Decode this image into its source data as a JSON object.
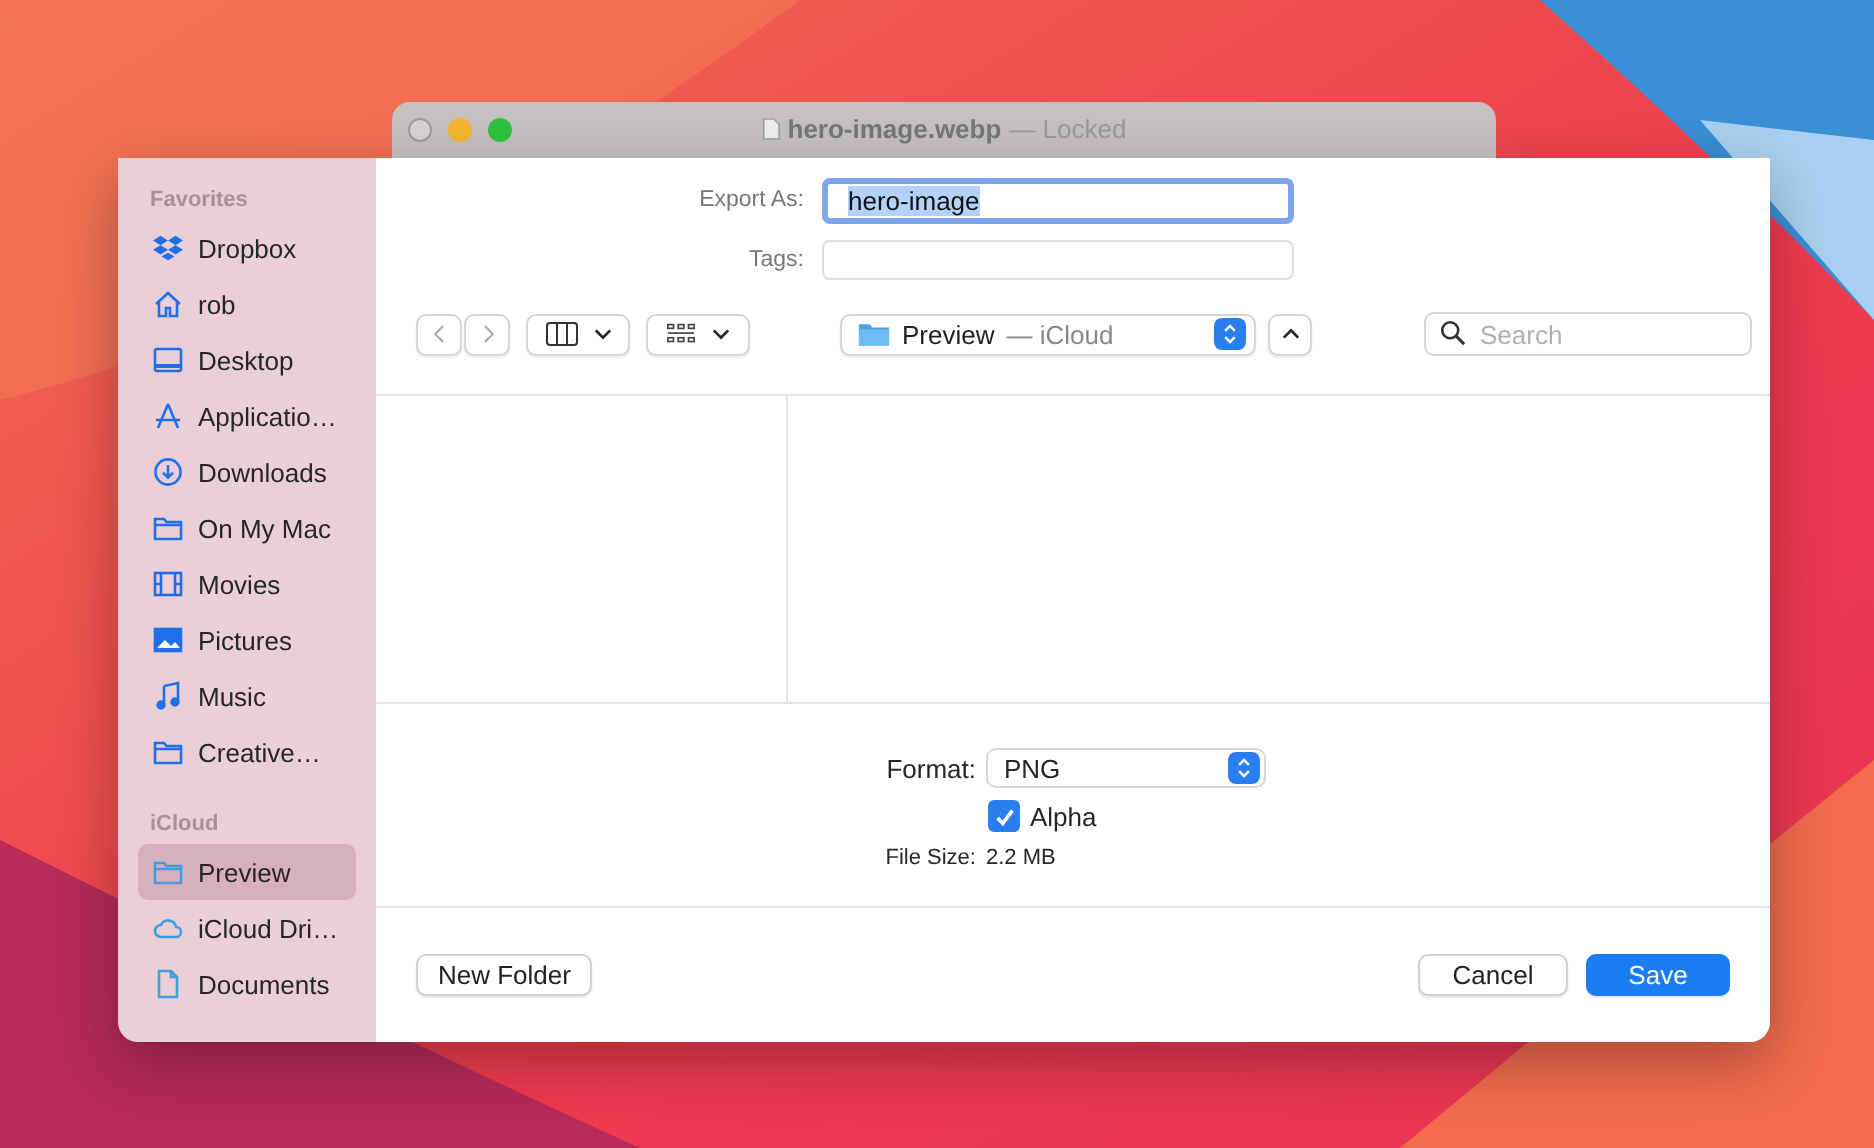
{
  "window": {
    "title": "hero-image.webp",
    "status": "— Locked"
  },
  "sidebar": {
    "sections": [
      {
        "heading": "Favorites",
        "items": [
          {
            "label": "Dropbox",
            "selected": false
          },
          {
            "label": "rob",
            "selected": false
          },
          {
            "label": "Desktop",
            "selected": false
          },
          {
            "label": "Applicatio…",
            "selected": false
          },
          {
            "label": "Downloads",
            "selected": false
          },
          {
            "label": "On My Mac",
            "selected": false
          },
          {
            "label": "Movies",
            "selected": false
          },
          {
            "label": "Pictures",
            "selected": false
          },
          {
            "label": "Music",
            "selected": false
          },
          {
            "label": "Creative…",
            "selected": false
          }
        ]
      },
      {
        "heading": "iCloud",
        "items": [
          {
            "label": "Preview",
            "selected": true
          },
          {
            "label": "iCloud Dri…",
            "selected": false
          },
          {
            "label": "Documents",
            "selected": false
          }
        ]
      }
    ]
  },
  "export_as": {
    "label": "Export As:",
    "value": "hero-image"
  },
  "tags": {
    "label": "Tags:"
  },
  "location": {
    "name": "Preview",
    "source": "— iCloud"
  },
  "search": {
    "placeholder": "Search"
  },
  "format": {
    "label": "Format:",
    "value": "PNG"
  },
  "alpha": {
    "label": "Alpha",
    "checked": true
  },
  "file_size": {
    "label": "File Size:",
    "value": "2.2 MB"
  },
  "buttons": {
    "new_folder": "New Folder",
    "cancel": "Cancel",
    "save": "Save"
  }
}
